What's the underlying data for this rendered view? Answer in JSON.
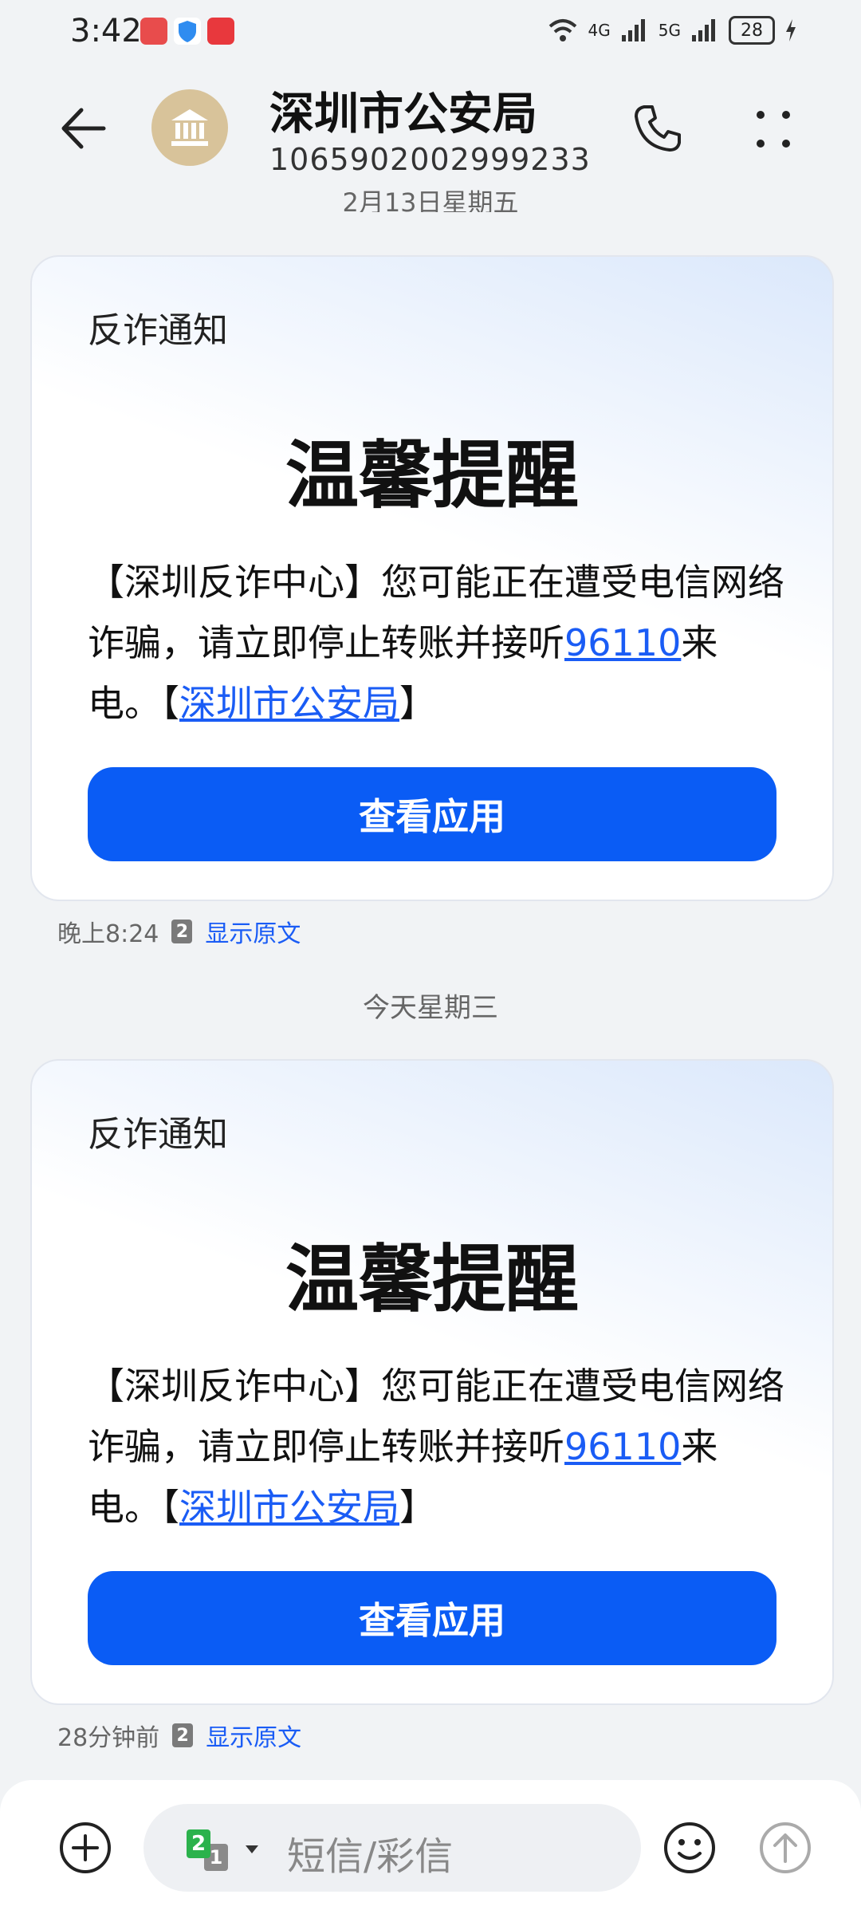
{
  "status_bar": {
    "time": "3:42",
    "network_1": "4G",
    "network_2": "5G",
    "battery": "28"
  },
  "header": {
    "title": "深圳市公安局",
    "number": "1065902002999233"
  },
  "date_top": "2月13日星期五",
  "date_mid": "今天星期三",
  "messages": [
    {
      "tag": "反诈通知",
      "headline": "温馨提醒",
      "text_1": "【深圳反诈中心】您可能正在遭受电信网络诈骗，请立即停止转账并接听",
      "link_number": "96110",
      "text_2": "来电。【",
      "link_org": "深圳市公安局",
      "text_3": "】",
      "button": "查看应用",
      "time": "晚上8:24",
      "sim": "2",
      "show_original": "显示原文"
    },
    {
      "tag": "反诈通知",
      "headline": "温馨提醒",
      "text_1": "【深圳反诈中心】您可能正在遭受电信网络诈骗，请立即停止转账并接听",
      "link_number": "96110",
      "text_2": "来电。【",
      "link_org": "深圳市公安局",
      "text_3": "】",
      "button": "查看应用",
      "time": "28分钟前",
      "sim": "2",
      "show_original": "显示原文"
    }
  ],
  "composer": {
    "sim_primary": "2",
    "sim_secondary": "1",
    "placeholder": "短信/彩信"
  },
  "colors": {
    "accent": "#0a5cf5",
    "link": "#1a5cf5",
    "avatar": "#d8c39a"
  }
}
